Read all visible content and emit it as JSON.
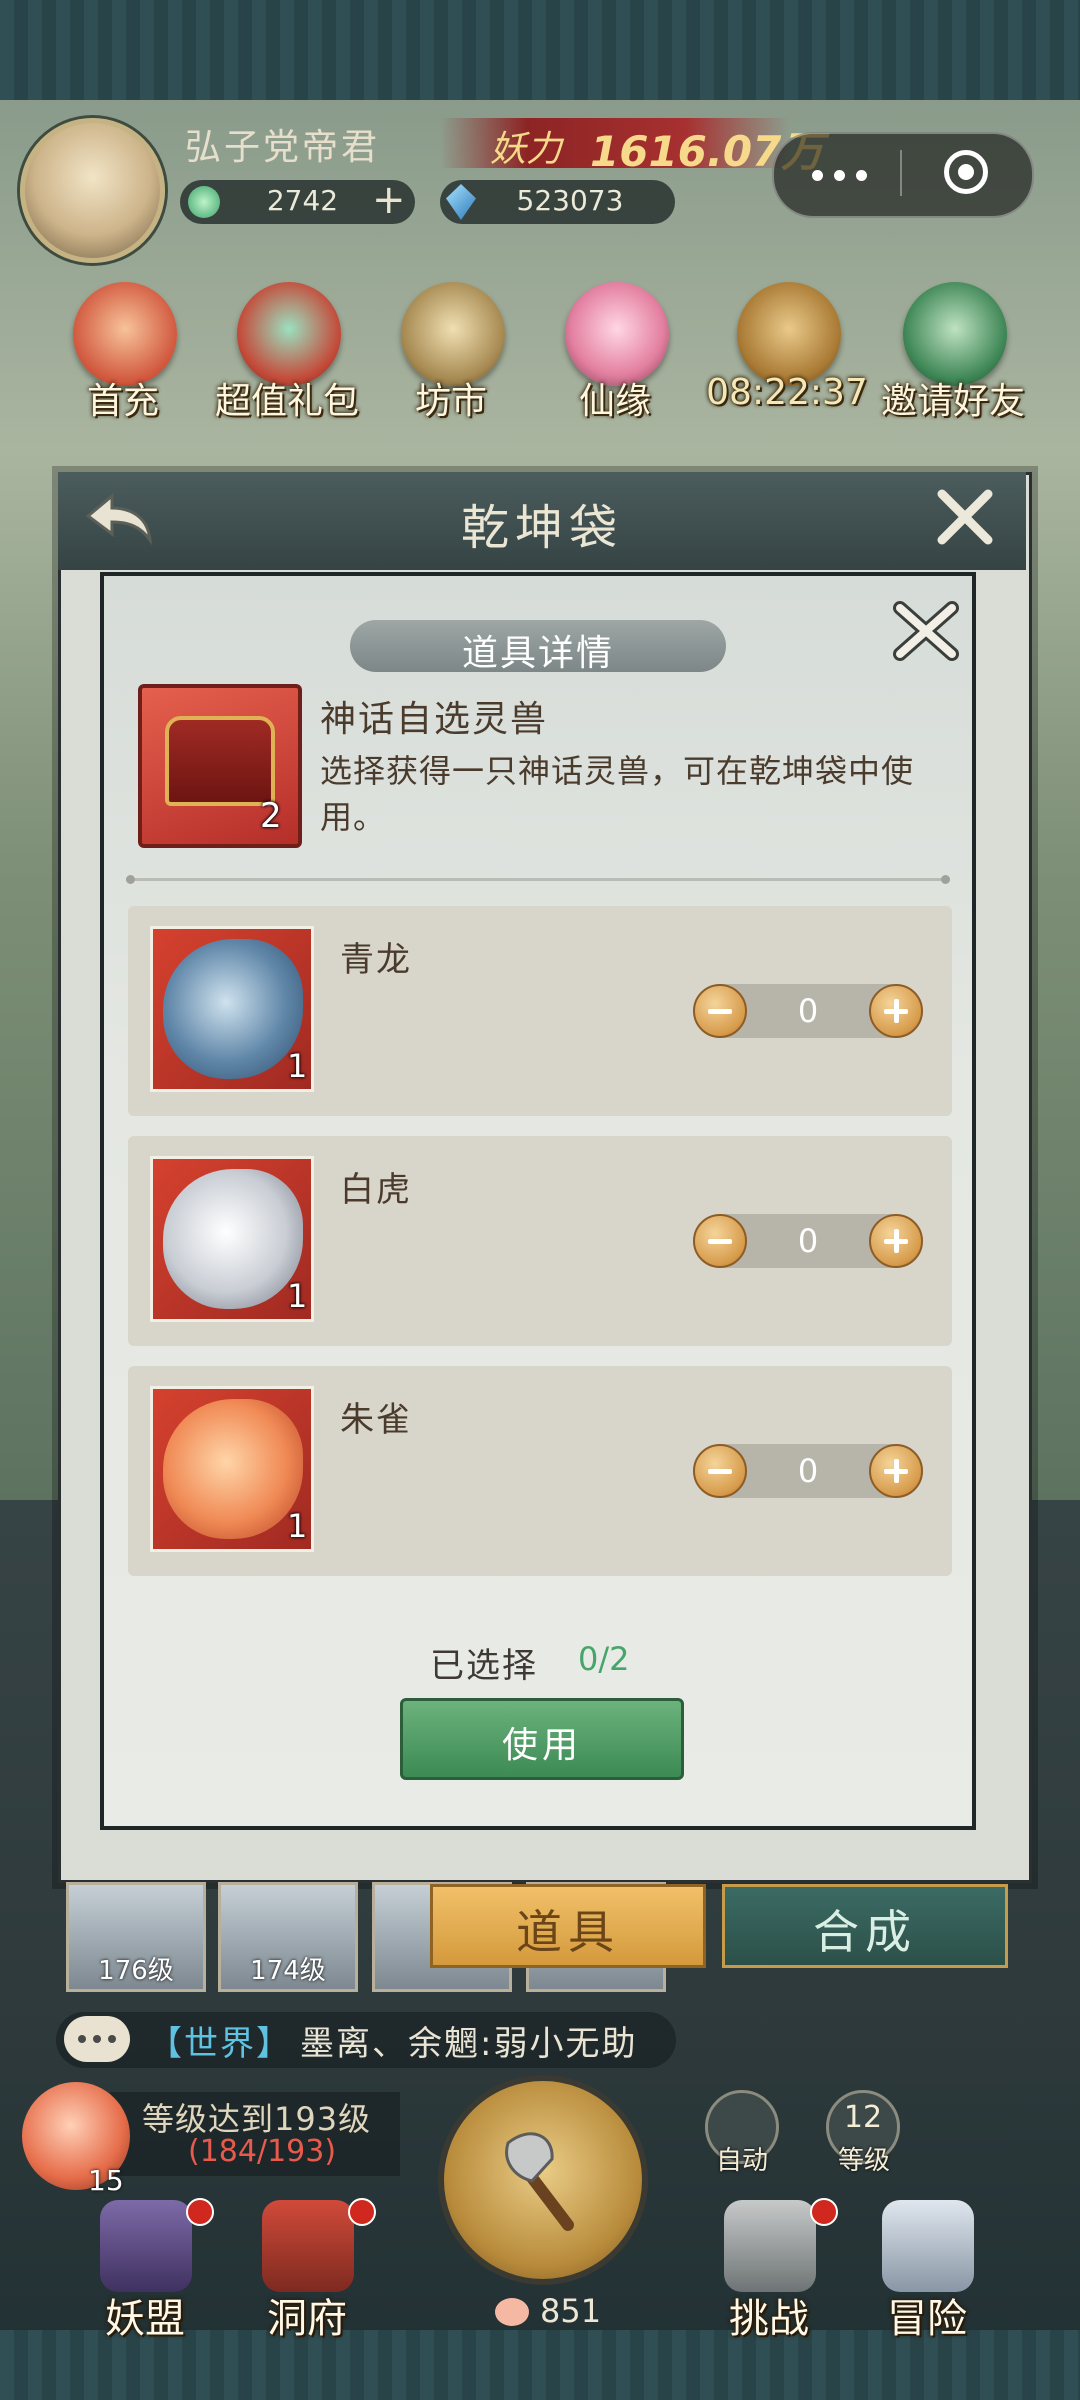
{
  "player": {
    "name": "弘子党帝君",
    "power_label": "妖力",
    "power_value": "1616.07万",
    "jade": "2742",
    "crystal": "523073"
  },
  "top_menu": [
    {
      "label": "首充",
      "icon": "first-recharge-icon"
    },
    {
      "label": "超值礼包",
      "icon": "gift-pack-icon"
    },
    {
      "label": "坊市",
      "icon": "market-icon"
    },
    {
      "label": "仙缘",
      "icon": "lotus-icon"
    },
    {
      "label": "08:22:37",
      "icon": "scroll-bundle-icon"
    },
    {
      "label": "邀请好友",
      "icon": "invite-book-icon"
    }
  ],
  "bag": {
    "title": "乾坤袋"
  },
  "modal": {
    "title": "道具详情",
    "item": {
      "name": "神话自选灵兽",
      "count": "2",
      "description": "选择获得一只神话灵兽，可在乾坤袋中使用。"
    },
    "options": [
      {
        "name": "青龙",
        "count": "1",
        "quantity": "0"
      },
      {
        "name": "白虎",
        "count": "1",
        "quantity": "0"
      },
      {
        "name": "朱雀",
        "count": "1",
        "quantity": "0"
      }
    ],
    "selected_label": "已选择",
    "selected_value": "0/2",
    "use_label": "使用"
  },
  "lower": {
    "cards": [
      "176级",
      "174级",
      "",
      ""
    ],
    "tab_items": "道具",
    "tab_synth": "合成"
  },
  "chat": {
    "channel": "【世界】",
    "message": "墨离、余魍:弱小无助"
  },
  "quest": {
    "text": "等级达到193级",
    "progress": "(184/193)",
    "count": "15"
  },
  "axe_count": "851",
  "auto_label": "自动",
  "level_value": "12",
  "level_label": "等级",
  "bottom_nav": [
    {
      "label": "妖盟",
      "icon": "alliance-icon"
    },
    {
      "label": "洞府",
      "icon": "cave-dwelling-icon"
    },
    {
      "label": "挑战",
      "icon": "challenge-icon"
    },
    {
      "label": "冒险",
      "icon": "adventure-icon"
    }
  ],
  "colors": {
    "accent_green": "#47a56a",
    "progress_red": "#e85b4c",
    "chat_channel": "#5ec2e0"
  }
}
